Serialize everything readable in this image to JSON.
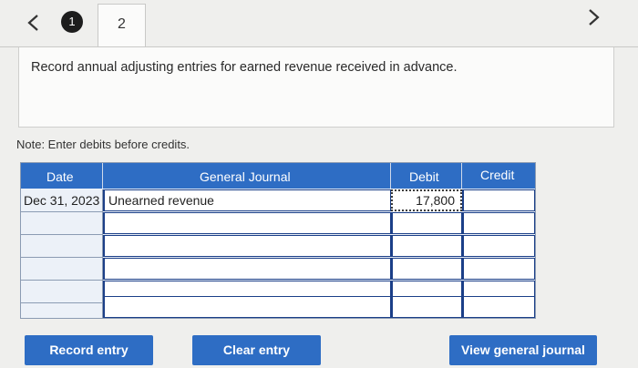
{
  "nav": {
    "current_step": "1",
    "active_tab": "2"
  },
  "instruction": "Record annual adjusting entries for earned revenue received in advance.",
  "note": "Note: Enter debits before credits.",
  "journal": {
    "headers": {
      "date": "Date",
      "general_journal": "General Journal",
      "debit": "Debit",
      "credit": "Credit"
    },
    "rows": [
      {
        "date": "Dec 31, 2023",
        "account": "Unearned revenue",
        "debit": "17,800",
        "credit": ""
      },
      {
        "date": "",
        "account": "",
        "debit": "",
        "credit": ""
      },
      {
        "date": "",
        "account": "",
        "debit": "",
        "credit": ""
      },
      {
        "date": "",
        "account": "",
        "debit": "",
        "credit": ""
      },
      {
        "date": "",
        "account": "",
        "debit": "",
        "credit": ""
      },
      {
        "date": "",
        "account": "",
        "debit": "",
        "credit": ""
      }
    ]
  },
  "buttons": {
    "record": "Record entry",
    "clear": "Clear entry",
    "view": "View general journal"
  },
  "colors": {
    "accent": "#2e6dc4",
    "input_border": "#1b3f88"
  }
}
